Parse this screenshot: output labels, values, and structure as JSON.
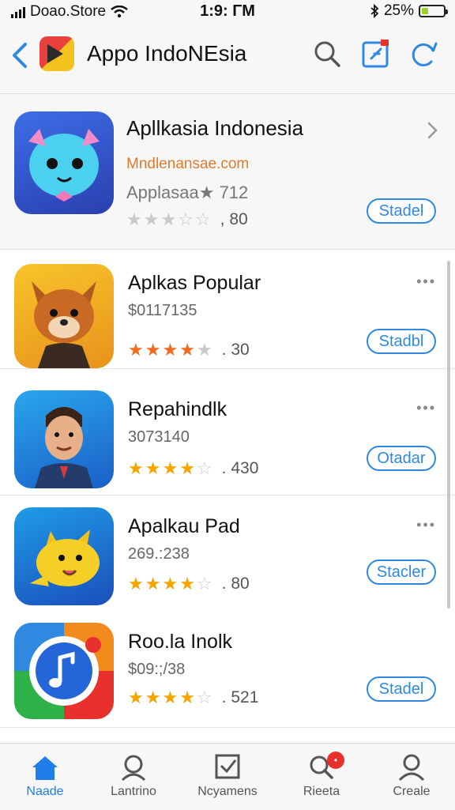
{
  "status_bar": {
    "carrier": "Doao.Store",
    "time": "1:9: ΓM",
    "battery": "25%"
  },
  "nav": {
    "title": "Appo IndoNEsia"
  },
  "featured": {
    "title": "Apllkasia Indonesia",
    "subtitle": "Mndlenansae.com",
    "meta": "Applasaa★ 712",
    "rating": 3,
    "count": ", 80",
    "button": "Stadel"
  },
  "apps": [
    {
      "title": "Aplkas Popular",
      "price": "$0117135",
      "rating": 4,
      "count": ". 30",
      "button": "Stadbl",
      "more": "•••"
    },
    {
      "title": "Repahindlk",
      "price": "3073140",
      "rating": 4,
      "count": ". 430",
      "button": "Otadar",
      "more": "•••"
    },
    {
      "title": "Apalkau Pad",
      "price": "269.:238",
      "rating": 4,
      "count": ". 80",
      "button": "Stacler",
      "more": "•••"
    },
    {
      "title": "Roo.la Inolk",
      "price": "$09:;/38",
      "rating": 4,
      "count": ". 521",
      "button": "Stadel",
      "more": ""
    }
  ],
  "tabs": [
    {
      "label": "Naade",
      "icon": "home-icon",
      "active": true
    },
    {
      "label": "Lantrino",
      "icon": "person-search-icon",
      "active": false
    },
    {
      "label": "Ncyamens",
      "icon": "checkbox-icon",
      "active": false
    },
    {
      "label": "Rieeta",
      "icon": "search-icon",
      "active": false,
      "badge": "•"
    },
    {
      "label": "Creale",
      "icon": "profile-icon",
      "active": false
    }
  ],
  "colors": {
    "accent": "#2f89e0",
    "star": "#f5a400",
    "star_first": "#f26b22"
  }
}
